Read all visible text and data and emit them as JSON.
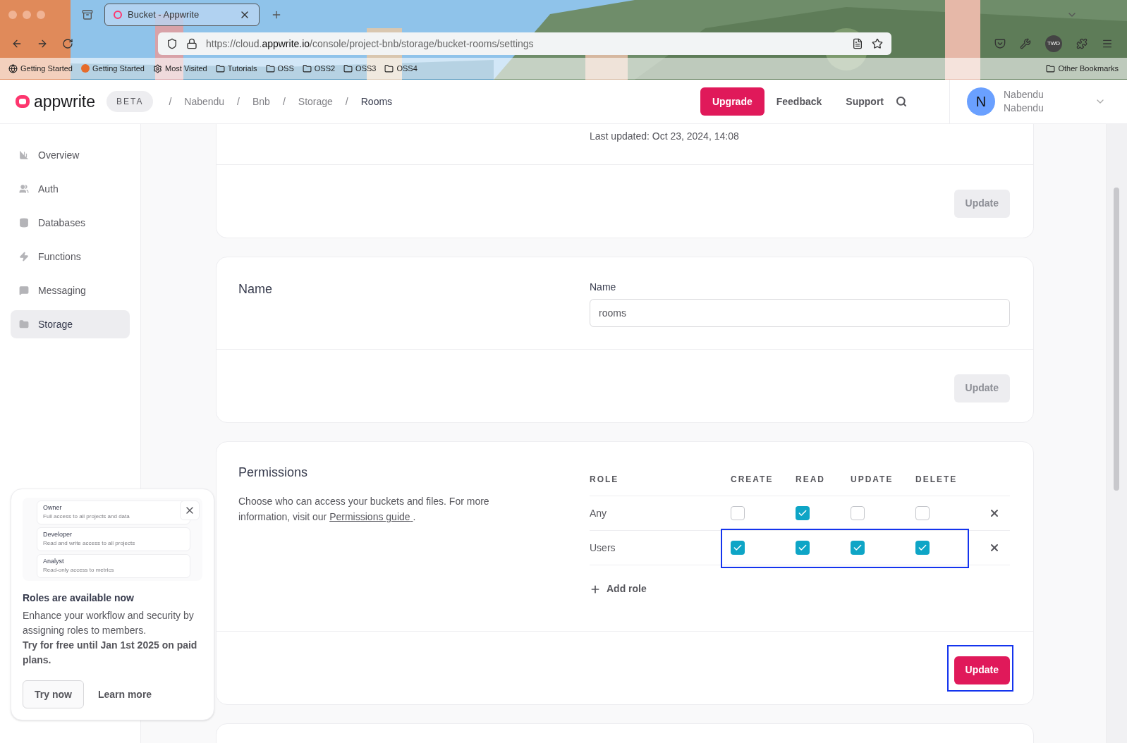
{
  "browser": {
    "tab_title": "Bucket - Appwrite",
    "url": {
      "prefix": "https://cloud.",
      "domain": "appwrite.io",
      "path": "/console/project-bnb/storage/bucket-rooms/settings"
    },
    "bookmarks": [
      "Getting Started",
      "Getting Started",
      "Most Visited",
      "Tutorials",
      "OSS",
      "OSS2",
      "OSS3",
      "OSS4"
    ],
    "other_bookmarks": "Other Bookmarks",
    "profile_badge": "TWD"
  },
  "header": {
    "logo": "appwrite",
    "badge": "BETA",
    "breadcrumbs": [
      {
        "separator": "/",
        "label": "Nabendu"
      },
      {
        "separator": "/",
        "label": "Bnb"
      },
      {
        "separator": "/",
        "label": "Storage"
      },
      {
        "separator": "/",
        "label": "Rooms"
      }
    ],
    "upgrade": "Upgrade",
    "links": [
      "Feedback",
      "Support"
    ],
    "user": {
      "initial": "N",
      "name": "Nabendu",
      "org": "Nabendu"
    }
  },
  "sidebar": {
    "items": [
      {
        "label": "Overview",
        "selected": false
      },
      {
        "label": "Auth",
        "selected": false
      },
      {
        "label": "Databases",
        "selected": false
      },
      {
        "label": "Functions",
        "selected": false
      },
      {
        "label": "Messaging",
        "selected": false
      },
      {
        "label": "Storage",
        "selected": true
      }
    ]
  },
  "cards": [
    {
      "kind": "info",
      "text": "Last updated: Oct 23, 2024, 14:08",
      "button": {
        "label": "Update",
        "disabled": true,
        "highlighted": false
      }
    },
    {
      "kind": "name",
      "title": "Name",
      "field_label": "Name",
      "value": "rooms",
      "button": {
        "label": "Update",
        "disabled": true,
        "highlighted": false
      }
    },
    {
      "kind": "permissions",
      "title": "Permissions",
      "description": "Choose who can access your buckets and files. For more information, visit our",
      "link": "Permissions guide",
      "after_link": ".",
      "columns": [
        "ROLE",
        "CREATE",
        "READ",
        "UPDATE",
        "DELETE"
      ],
      "rows": [
        {
          "role": "Any",
          "checks": [
            false,
            true,
            false,
            false
          ],
          "highlighted": false
        },
        {
          "role": "Users",
          "checks": [
            true,
            true,
            true,
            true
          ],
          "highlighted": true
        }
      ],
      "add_role": "Add role",
      "button": {
        "label": "Update",
        "disabled": false,
        "highlighted": true
      }
    }
  ],
  "promo": {
    "roles": [
      {
        "name": "Owner",
        "desc": "Full access to all projects and data"
      },
      {
        "name": "Developer",
        "desc": "Read and write access to all projects"
      },
      {
        "name": "Analyst",
        "desc": "Read-only access to metrics"
      }
    ],
    "title": "Roles are available now",
    "body": "Enhance your workflow and security by assigning roles to members.",
    "bold": "Try for free until Jan 1st 2025 on paid plans.",
    "primary": "Try now",
    "secondary": "Learn more"
  }
}
